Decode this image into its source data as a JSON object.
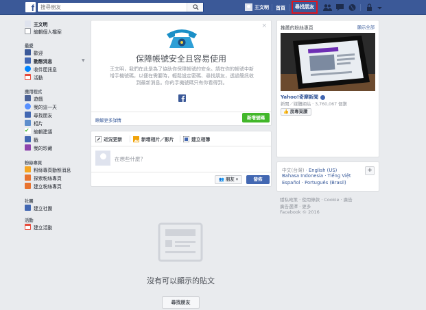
{
  "topbar": {
    "search_placeholder": "搜尋朋友",
    "user_name": "王文明",
    "home": "首頁",
    "find_friends": "尋找朋友"
  },
  "sidebar": {
    "profile_name": "王文明",
    "edit_profile": "編輯個人檔案",
    "favorites_head": "最愛",
    "favorites": [
      "歡迎",
      "動態消息",
      "收件匣訊息",
      "活動"
    ],
    "apps_head": "應用程式",
    "apps": [
      "遊戲",
      "我的這一天",
      "尋找朋友",
      "相片",
      "編輯建議",
      "戳",
      "我的珍藏"
    ],
    "pages_head": "粉絲專頁",
    "pages": [
      "粉絲專頁動態消息",
      "探索粉絲專頁",
      "建立粉絲專頁"
    ],
    "groups_head": "社團",
    "groups": [
      "建立社團"
    ],
    "events_head": "活動",
    "events": [
      "建立活動"
    ]
  },
  "promo": {
    "title": "保障帳號安全且容易使用",
    "body": "王文明，我們在此是為了協助你保障帳號的安全。請在你的帳號中新增手機號碼，以便在需要時，輕鬆設定密碼、尋找朋友，透過簡訊收到最新消息。你的手機號碼只有你看得到。",
    "learn_more": "瞭解更多詳情",
    "add_phone": "新增號碼",
    "close": "×"
  },
  "composer": {
    "tab_status": "近況更新",
    "tab_photo": "新增相片／影片",
    "tab_album": "建立相簿",
    "placeholder": "在想些什麼？",
    "audience": "朋友",
    "post": "發佈"
  },
  "feed": {
    "empty_text": "沒有可以顯示的貼文",
    "find_friends": "尋找朋友"
  },
  "right": {
    "ad_heading": "推薦的粉絲專頁",
    "see_all": "顯示全部",
    "page_name": "Yahoo!奇摩新聞",
    "page_meta": "新聞／媒體網站 · 3,760,067 個讚",
    "like_label": "說專頁讚",
    "languages_line1_current": "中文(台灣)",
    "languages_line1": [
      "English (US)"
    ],
    "languages_line2": [
      "Bahasa Indonesia",
      "Tiếng Việt"
    ],
    "languages_line3": [
      "Español",
      "Português (Brasil)"
    ],
    "footer_line1": "隱私政策 · 使用條款 · Cookie · 廣告",
    "footer_line2": "廣告選擇 · 更多",
    "footer_copy": "Facebook © 2016"
  },
  "colors": {
    "brand": "#3b5998",
    "green": "#42b72a",
    "highlight": "#e0141e"
  }
}
